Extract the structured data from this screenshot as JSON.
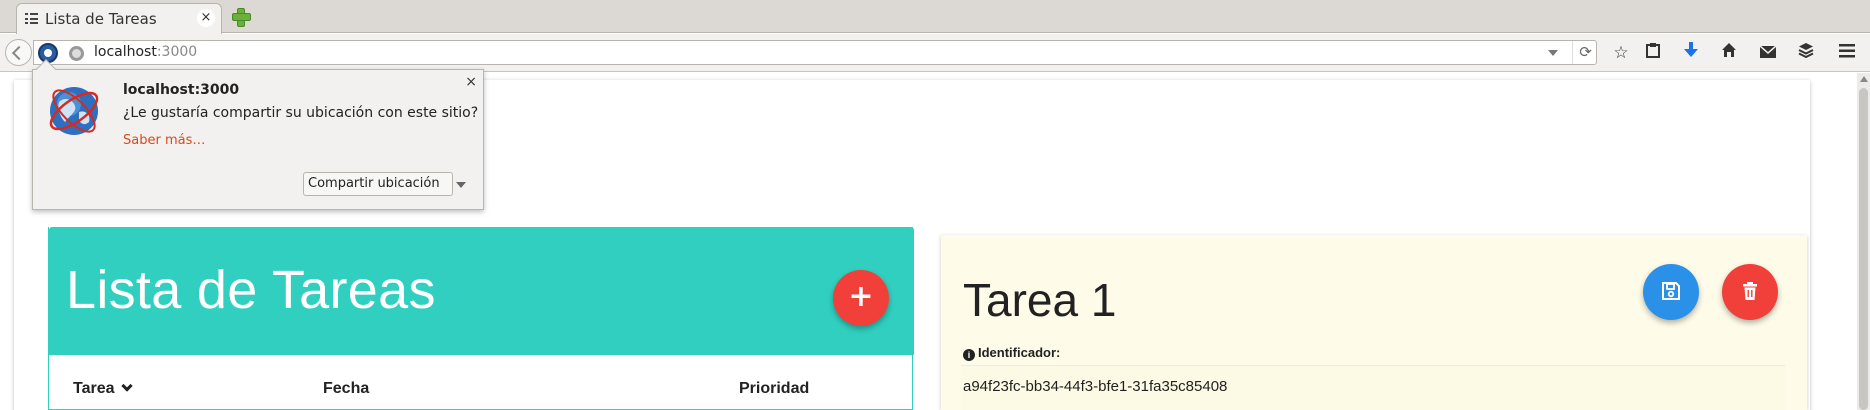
{
  "browser": {
    "tab": {
      "title": "Lista de Tareas",
      "close_glyph": "×"
    },
    "url": {
      "host": "localhost",
      "port": ":3000"
    },
    "reload_glyph": "⟳",
    "toolbar_icons": [
      "bookmark-star-icon",
      "clipboard-icon",
      "download-icon",
      "home-icon",
      "mail-icon",
      "pocket-icon",
      "menu-icon"
    ]
  },
  "geolocation_prompt": {
    "host": "localhost:3000",
    "message": "¿Le gustaría compartir su ubicación con este sitio?",
    "learn_more": "Saber más…",
    "action_label": "Compartir ubicación",
    "close_glyph": "×"
  },
  "task_list": {
    "title": "Lista de Tareas",
    "add_glyph": "+",
    "columns": [
      "Tarea",
      "Fecha",
      "Prioridad"
    ],
    "header_color": "#31cfbf"
  },
  "task_detail": {
    "title": "Tarea 1",
    "id_label": "Identificador:",
    "id_value": "a94f23fc-bb34-44f3-bfe1-31fa35c85408",
    "background": "#fefce8"
  },
  "colors": {
    "save": "#2a90e8",
    "danger": "#f1403a",
    "link": "#d74b19"
  }
}
